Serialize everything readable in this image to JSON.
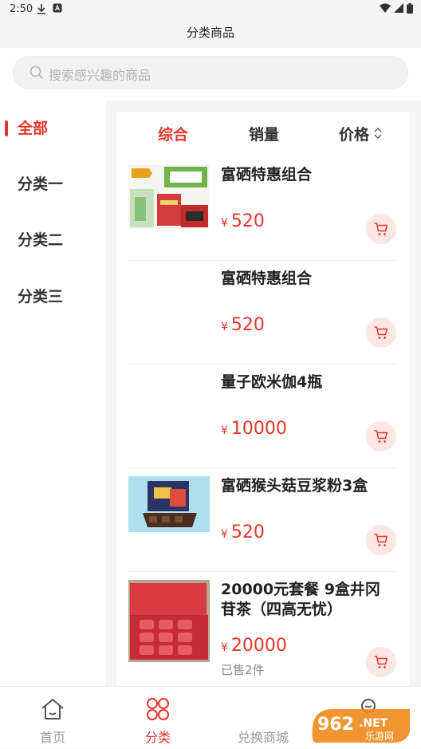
{
  "status": {
    "time": "2:50"
  },
  "header": {
    "title": "分类商品"
  },
  "search": {
    "placeholder": "搜索感兴趣的商品"
  },
  "sidebar": {
    "items": [
      {
        "label": "全部",
        "active": true
      },
      {
        "label": "分类一"
      },
      {
        "label": "分类二"
      },
      {
        "label": "分类三"
      }
    ]
  },
  "sort": {
    "tabs": [
      {
        "label": "综合",
        "active": true
      },
      {
        "label": "销量"
      },
      {
        "label": "价格"
      }
    ]
  },
  "currency": "¥",
  "products": [
    {
      "name": "富硒特惠组合",
      "price": "520",
      "sold": ""
    },
    {
      "name": "富硒特惠组合",
      "price": "520",
      "sold": ""
    },
    {
      "name": "量子欧米伽4瓶",
      "price": "10000",
      "sold": ""
    },
    {
      "name": "富硒猴头菇豆浆粉3盒",
      "price": "520",
      "sold": ""
    },
    {
      "name": "20000元套餐 9盒井冈苷茶（四高无忧）",
      "price": "20000",
      "sold": "已售2件"
    }
  ],
  "tabbar": {
    "items": [
      {
        "label": "首页",
        "icon": "home-icon"
      },
      {
        "label": "分类",
        "icon": "grid-icon",
        "active": true
      },
      {
        "label": "兑换商城",
        "icon": "exchange-icon"
      },
      {
        "label": "",
        "icon": "user-icon"
      }
    ]
  },
  "watermark": {
    "text": "962.NET",
    "sub": "乐游网"
  },
  "colors": {
    "accent": "#e7362a",
    "cart_bg": "#fde6e4"
  }
}
